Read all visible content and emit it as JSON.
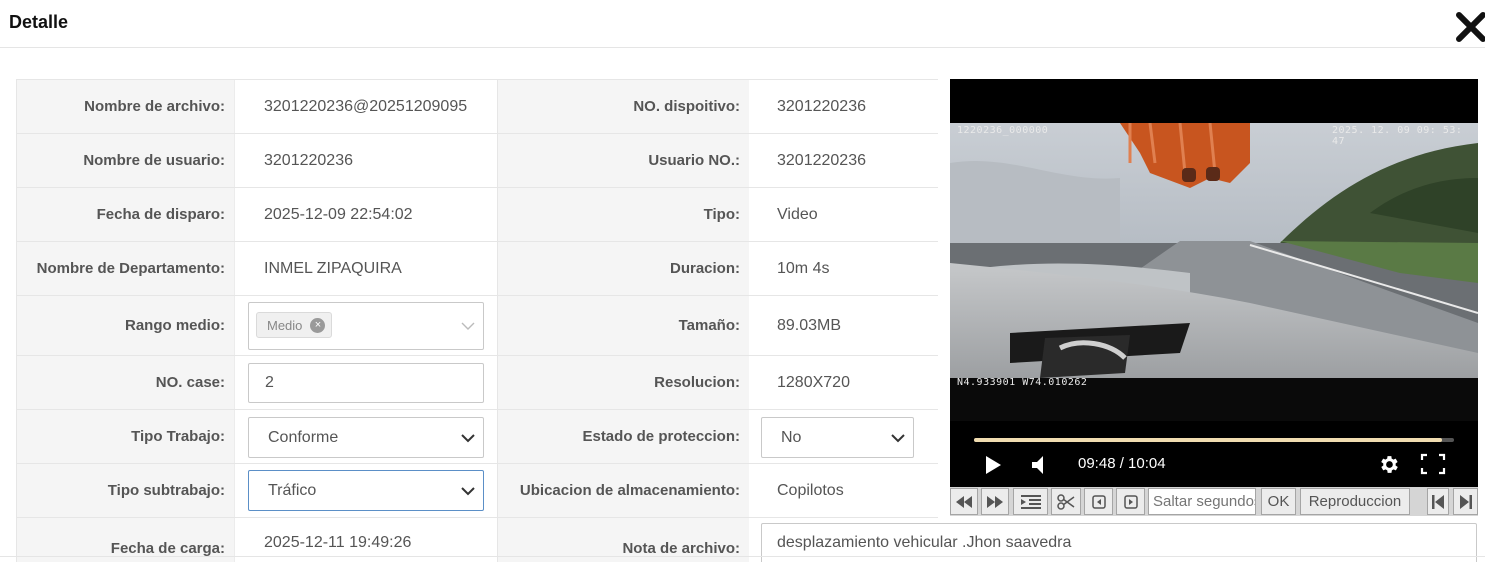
{
  "dialog": {
    "title": "Detalle",
    "close_icon": "close-x-icon"
  },
  "details": {
    "nombre_archivo": {
      "label": "Nombre de archivo:",
      "value": "3201220236@20251209095"
    },
    "nombre_usuario": {
      "label": "Nombre de usuario:",
      "value": "3201220236"
    },
    "fecha_disparo": {
      "label": "Fecha de disparo:",
      "value": "2025-12-09 22:54:02"
    },
    "departamento": {
      "label": "Nombre de Departamento:",
      "value": "INMEL ZIPAQUIRA"
    },
    "rango_medio": {
      "label": "Rango medio:",
      "tag": "Medio"
    },
    "no_case": {
      "label": "NO. case:",
      "value": "2"
    },
    "tipo_trabajo": {
      "label": "Tipo Trabajo:",
      "selected": "Conforme"
    },
    "tipo_subtrabajo": {
      "label": "Tipo subtrabajo:",
      "selected": "Tráfico"
    },
    "fecha_carga": {
      "label": "Fecha de carga:",
      "value": "2025-12-11 19:49:26"
    },
    "no_dispositivo": {
      "label": "NO. dispoitivo:",
      "value": "3201220236"
    },
    "usuario_no": {
      "label": "Usuario NO.:",
      "value": "3201220236"
    },
    "tipo": {
      "label": "Tipo:",
      "value": "Video"
    },
    "duracion": {
      "label": "Duracion:",
      "value": "10m 4s"
    },
    "tamano": {
      "label": "Tamaño:",
      "value": "89.03MB"
    },
    "resolucion": {
      "label": "Resolucion:",
      "value": "1280X720"
    },
    "estado_proteccion": {
      "label": "Estado de proteccion:",
      "selected": "No"
    },
    "ubicacion": {
      "label": "Ubicacion de almacenamiento:",
      "value": "Copilotos"
    },
    "nota_archivo": {
      "label": "Nota de archivo:",
      "value": "desplazamiento vehicular .Jhon saavedra"
    }
  },
  "video": {
    "osd_device": "1220236_000000",
    "osd_datetime": "2025. 12. 09  09: 53: 47",
    "osd_gps": "N4.933901  W74.010262",
    "time_display": "09:48 / 10:04",
    "progress_fraction": 0.974,
    "icons": {
      "play": "play-icon",
      "volume": "volume-icon",
      "settings": "gear-icon",
      "fullscreen": "fullscreen-icon"
    }
  },
  "toolbar": {
    "icons": [
      "rewind-icon",
      "fast-forward-icon",
      "list-indent-icon",
      "scissors-icon",
      "step-back-icon",
      "step-forward-icon",
      "skip-to-start-icon",
      "skip-to-end-icon"
    ],
    "seek_placeholder": "Saltar segundos",
    "ok_label": "OK",
    "playback_label": "Reproduccion"
  },
  "colors": {
    "label_bg": "#f5f5f5",
    "border": "#e6e6e6",
    "progress_played": "#f0dcb0",
    "focus_border": "#5b8fc7"
  }
}
